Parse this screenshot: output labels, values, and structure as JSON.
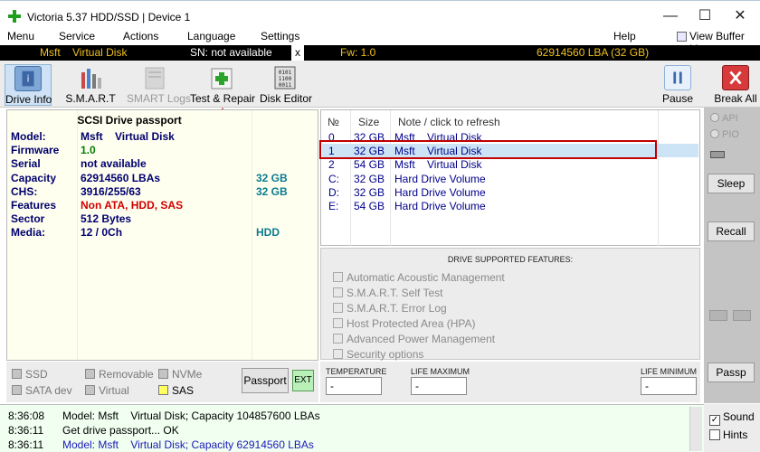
{
  "window": {
    "title": "Victoria 5.37 HDD/SSD | Device 1",
    "minimize": "—",
    "maximize": "☐",
    "close": "✕"
  },
  "menu": {
    "items": [
      "Menu",
      "Service",
      "Actions",
      "Language",
      "Settings"
    ],
    "help": "Help",
    "view_buffer": "View Buffer Live"
  },
  "status": {
    "model": "Msft    Virtual Disk",
    "sn": "SN: not available",
    "sn_close": "x",
    "fw": "Fw: 1.0",
    "lba": "62914560 LBA (32 GB)"
  },
  "toolbar": {
    "items": [
      "Drive Info",
      "S.M.A.R.T",
      "SMART Logs",
      "Test & Repair",
      "Disk Editor"
    ],
    "pause": "Pause",
    "break_all": "Break All"
  },
  "passport": {
    "title": "SCSI  Drive passport",
    "rows": [
      {
        "key": "Model:",
        "value": "Msft    Virtual Disk",
        "extra": ""
      },
      {
        "key": "Firmware",
        "value": "1.0",
        "extra": ""
      },
      {
        "key": "Serial",
        "value": "not available",
        "extra": ""
      },
      {
        "key": "Capacity",
        "value": "62914560 LBAs",
        "extra": "32 GB"
      },
      {
        "key": "CHS:",
        "value": "3916/255/63",
        "extra": "32 GB"
      },
      {
        "key": "Features",
        "value": "Non ATA, HDD, SAS",
        "extra": ""
      },
      {
        "key": "Sector",
        "value": "512 Bytes",
        "extra": ""
      },
      {
        "key": "Media:",
        "value": "12 / 0Ch",
        "extra": "HDD"
      }
    ],
    "colors": {
      "key": "#00006e",
      "firmware": "#008000",
      "features": "#d00000",
      "extra": "#0a7b8f"
    }
  },
  "legend": {
    "items": [
      "SSD",
      "Removable",
      "NVMe",
      "SATA dev",
      "Virtual",
      "SAS"
    ],
    "passport_button": "Passport",
    "ext_button": "EXT"
  },
  "disks": {
    "headers": [
      "№",
      "Size",
      "Note / click to refresh"
    ],
    "rows": [
      {
        "n": "0",
        "size": "32 GB",
        "note": "Msft    Virtual Disk"
      },
      {
        "n": "1",
        "size": "32 GB",
        "note": "Msft    Virtual Disk"
      },
      {
        "n": "2",
        "size": "54 GB",
        "note": "Msft    Virtual Disk"
      },
      {
        "n": "C:",
        "size": "32 GB",
        "note": "Hard Drive Volume"
      },
      {
        "n": "D:",
        "size": "32 GB",
        "note": "Hard Drive Volume"
      },
      {
        "n": "E:",
        "size": "54 GB",
        "note": "Hard Drive Volume"
      }
    ],
    "selected_row": "1"
  },
  "features": {
    "title": "DRIVE SUPPORTED FEATURES:",
    "items": [
      "Automatic Acoustic Management",
      "S.M.A.R.T. Self Test",
      "S.M.A.R.T. Error Log",
      "Host Protected Area (HPA)",
      "Advanced Power Management",
      "Security options"
    ]
  },
  "temperature": {
    "temp_label": "TEMPERATURE",
    "life_max_label": "LIFE MAXIMUM",
    "life_min_label": "LIFE MINIMUM",
    "temp_value": "-",
    "life_max_value": "-",
    "life_min_value": "-"
  },
  "right": {
    "api": "API",
    "pio": "PIO",
    "sleep": "Sleep",
    "recall": "Recall",
    "passp": "Passp"
  },
  "log": {
    "rows": [
      {
        "time": "8:36:08",
        "msg": "Model: Msft    Virtual Disk; Capacity 104857600 LBAs",
        "color": "#000000"
      },
      {
        "time": "8:36:11",
        "msg": "Get drive passport... OK",
        "color": "#000000"
      },
      {
        "time": "8:36:11",
        "msg": "Model: Msft    Virtual Disk; Capacity 62914560 LBAs",
        "color": "#1a1ab8"
      }
    ]
  },
  "sound": {
    "sound_label": "Sound",
    "hints_label": "Hints"
  },
  "annotation_color": "#c00000"
}
